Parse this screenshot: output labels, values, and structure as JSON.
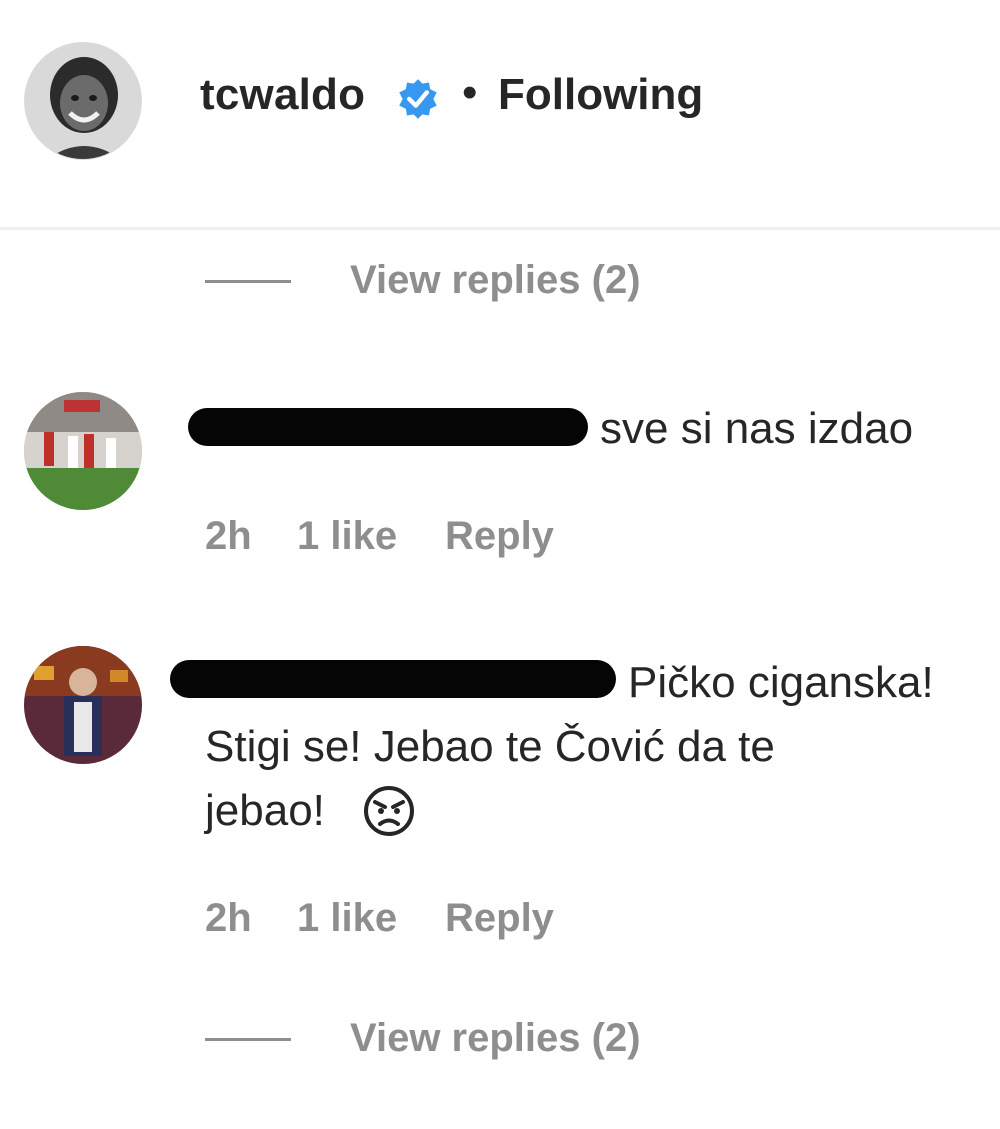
{
  "post_header": {
    "username": "tcwaldo",
    "separator": "•",
    "follow_status": "Following",
    "verified_icon": "verified-badge-icon",
    "accent_color": "#3897f0"
  },
  "replies_top": {
    "label": "View replies (2)"
  },
  "comments": [
    {
      "username_redacted": true,
      "text": "sve si nas izdao",
      "time": "2h",
      "likes": "1 like",
      "reply_label": "Reply"
    },
    {
      "username_redacted": true,
      "text_line1": "Pičko ciganska!",
      "text_line2": "Stigi se! Jebao te Čović da te",
      "text_line3": "jebao!",
      "emoji": "angry-face-icon",
      "time": "2h",
      "likes": "1 like",
      "reply_label": "Reply"
    }
  ],
  "replies_bottom": {
    "label": "View replies (2)"
  },
  "colors": {
    "text_primary": "#262626",
    "text_secondary": "#8e8e8e",
    "divider": "#efefef"
  }
}
